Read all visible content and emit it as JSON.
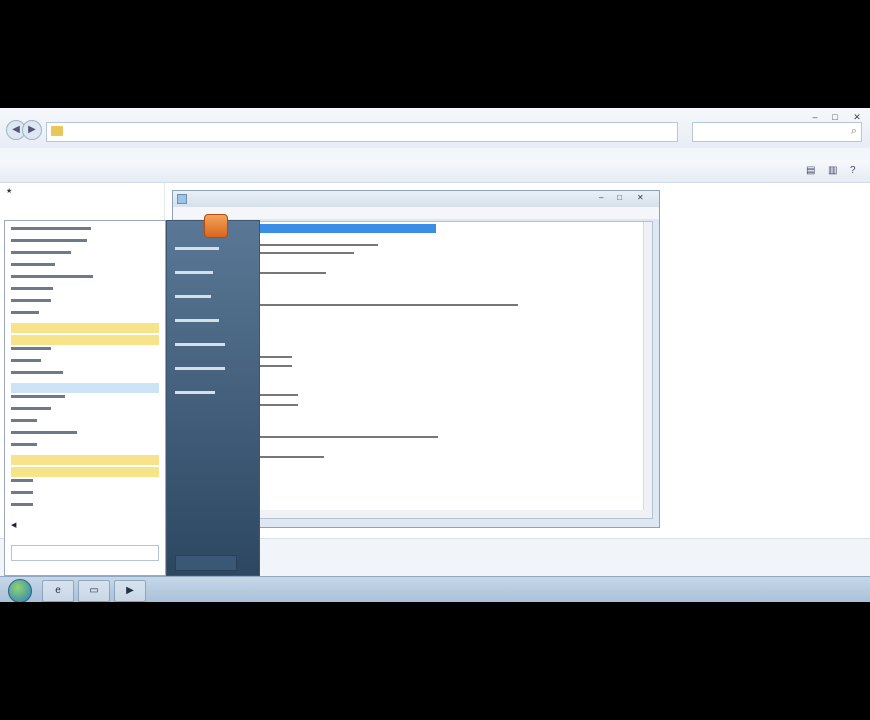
{
  "explorer": {
    "address_text": "",
    "menu": [
      "",
      "",
      "",
      "",
      ""
    ],
    "toolbar": [
      "",
      "",
      "",
      "",
      ""
    ],
    "status_text": ""
  },
  "start_menu": {
    "power_label": ""
  },
  "notepad": {
    "title": "",
    "menu": [
      "",
      "",
      "",
      "",
      ""
    ],
    "lines": []
  },
  "taskbar": {
    "clock": ""
  },
  "icons": [
    "back-icon",
    "forward-icon",
    "folder-icon",
    "search-icon",
    "start-orb-icon",
    "close-icon",
    "minimize-icon",
    "maximize-icon"
  ],
  "colors": {
    "selection": "#3a8ee6",
    "highlight": "#f7e48a",
    "start_right": "#2d4761"
  }
}
